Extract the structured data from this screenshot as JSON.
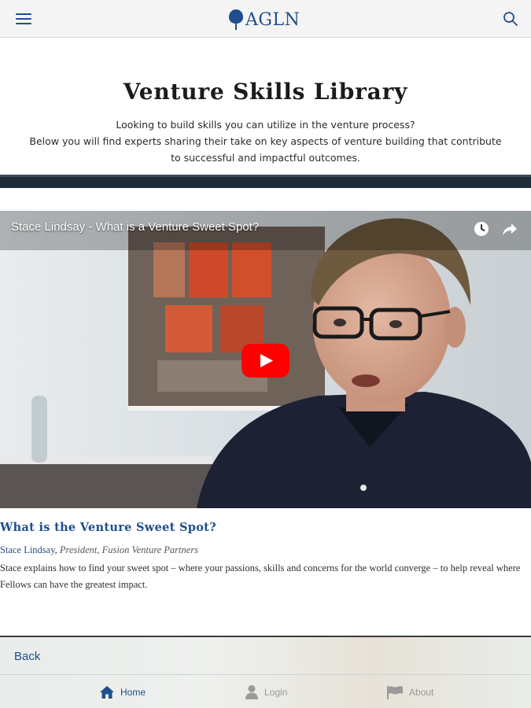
{
  "topbar": {
    "logo_text": "AGLN",
    "menu_icon": "hamburger-menu-icon",
    "search_icon": "search-icon",
    "accent": "#1f4e8c"
  },
  "header": {
    "title": "Venture Skills Library",
    "intro_line1": "Looking to build skills you can utilize in the venture process?",
    "intro_line2": "Below you will find experts sharing their take on key aspects of venture building that contribute",
    "intro_line3": "to successful and impactful outcomes."
  },
  "video": {
    "title": "Stace Lindsay - What is a Venture Sweet Spot?",
    "watch_later_icon": "clock-icon",
    "share_icon": "share-arrow-icon",
    "play_icon": "youtube-play-icon",
    "play_color": "#ff0000"
  },
  "entry": {
    "heading": "What is the Venture Sweet Spot?",
    "speaker": "Stace Lindsay",
    "role": "President, Fusion Venture Partners",
    "description": "Stace explains how to find your sweet spot – where your passions, skills and concerns for the world converge – to help reveal where Fellows can have the greatest impact."
  },
  "footer": {
    "back_label": "Back",
    "tabs": [
      {
        "label": "Home",
        "icon": "home-icon",
        "active": true
      },
      {
        "label": "Login",
        "icon": "user-icon",
        "active": false
      },
      {
        "label": "About",
        "icon": "flag-icon",
        "active": false
      }
    ]
  }
}
